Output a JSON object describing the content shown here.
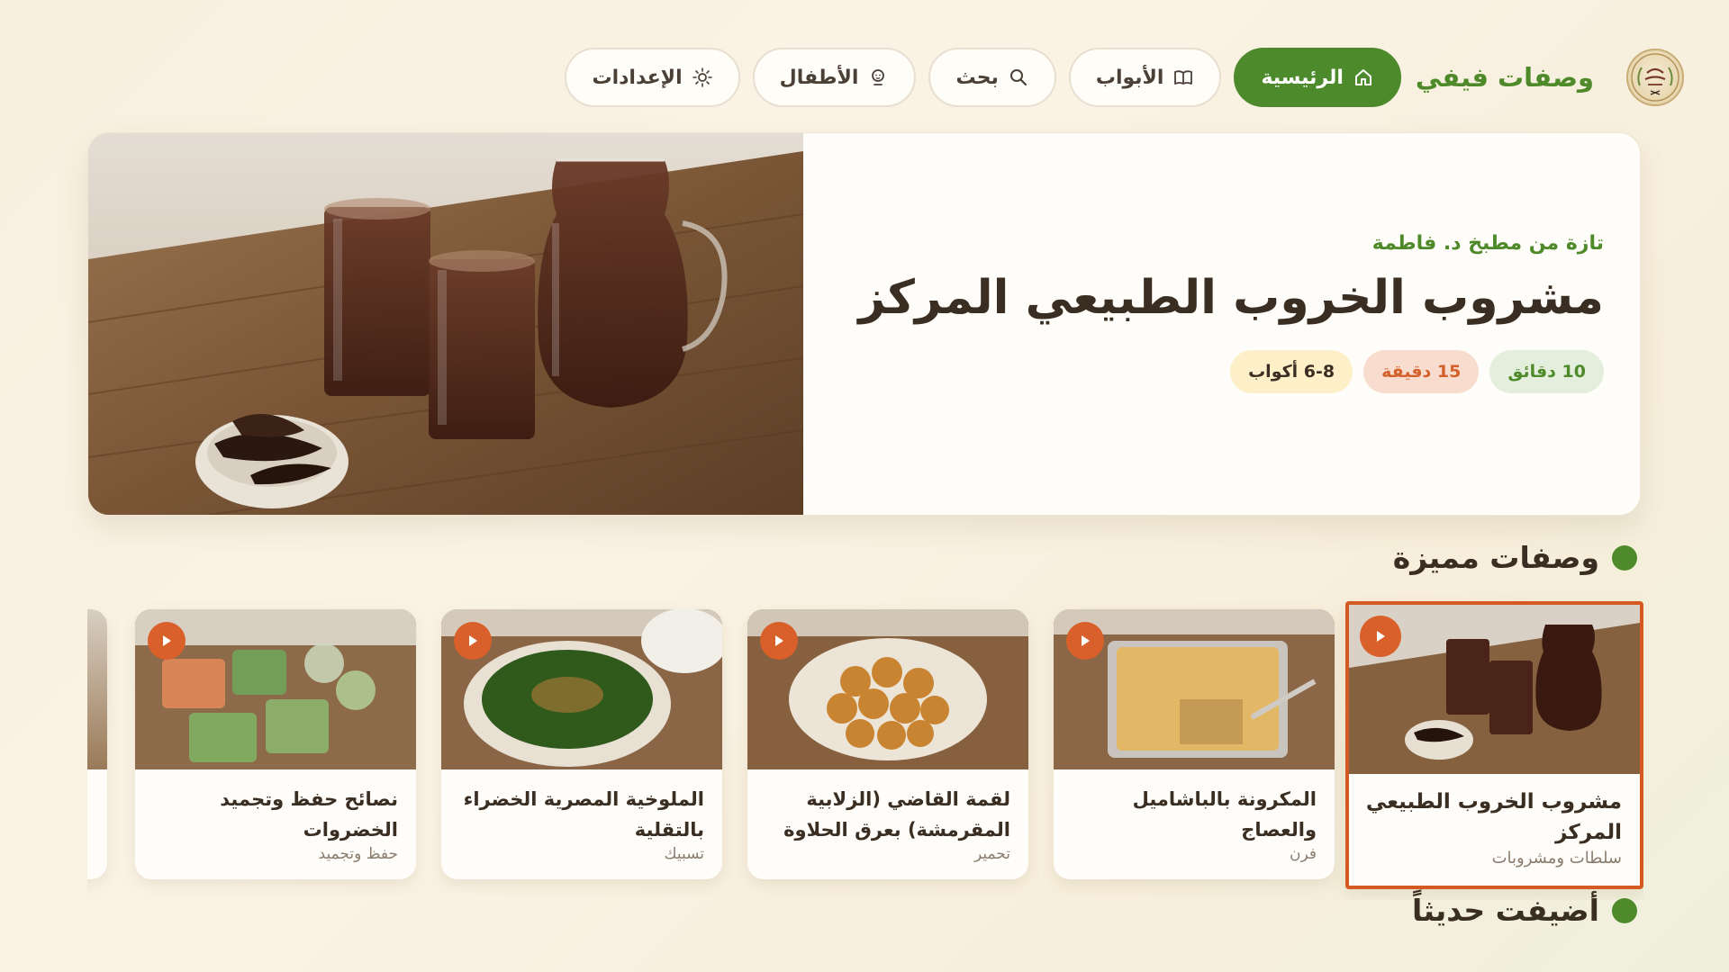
{
  "brand": {
    "name": "وصفات فيفي",
    "logo_icon": "fatma-seal-logo"
  },
  "nav": [
    {
      "label": "الرئيسية",
      "icon": "home-icon",
      "active": true
    },
    {
      "label": "الأبواب",
      "icon": "book-icon",
      "active": false
    },
    {
      "label": "بحث",
      "icon": "search-icon",
      "active": false
    },
    {
      "label": "الأطفال",
      "icon": "child-icon",
      "active": false
    },
    {
      "label": "الإعدادات",
      "icon": "sun-gear-icon",
      "active": false
    }
  ],
  "hero": {
    "subtitle": "تازة من مطبخ د. فاطمة",
    "title": "مشروب الخروب الطبيعي المركز",
    "chips": [
      "10 دقائق",
      "15 دقيقة",
      "6-8 أكواب"
    ]
  },
  "sections": {
    "featured": "وصفات مميزة",
    "recent": "أضيفت حديثاً"
  },
  "cards": [
    {
      "name": "مشروب الخروب الطبيعي المركز",
      "category": "سلطات ومشروبات",
      "selected": true
    },
    {
      "name": "المكرونة بالباشاميل والعصاج",
      "category": "فرن",
      "selected": false
    },
    {
      "name": "لقمة القاضي (الزلابية المقرمشة) بعرق الحلاوة",
      "category": "تحمير",
      "selected": false
    },
    {
      "name": "الملوخية المصرية الخضراء بالتقلية",
      "category": "تسبيك",
      "selected": false
    },
    {
      "name": "نصائح حفظ وتجميد الخضروات",
      "category": "حفظ وتجميد",
      "selected": false
    }
  ],
  "colors": {
    "accent_green": "#4d8a2c",
    "accent_orange": "#d9602a",
    "background": "#faf3e5"
  }
}
